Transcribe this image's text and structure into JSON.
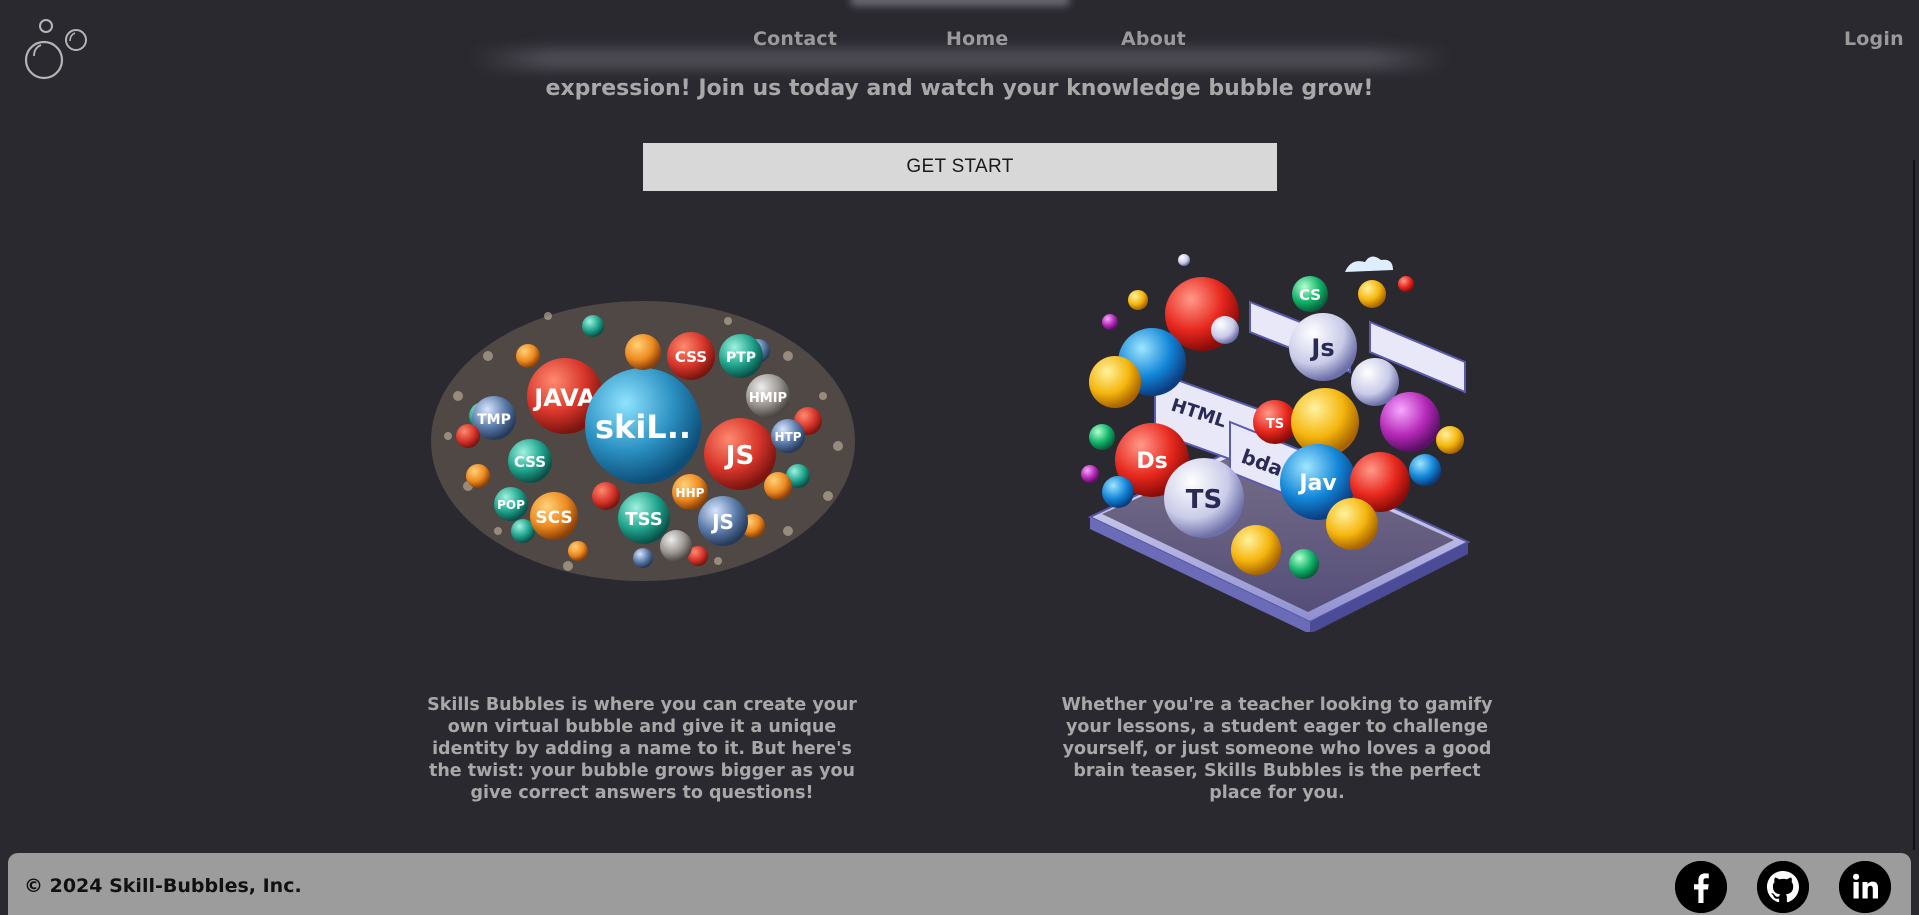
{
  "nav": {
    "contact": "Contact",
    "home": "Home",
    "about": "About",
    "login": "Login"
  },
  "hero": {
    "tagline": "expression! Join us today and watch your knowledge bubble grow!",
    "cta_label": "GET START"
  },
  "left_illustration": {
    "center_label": "skiL..",
    "bubble_labels": [
      "JAVA",
      "CSS",
      "JS",
      "TSS",
      "SCS",
      "JS",
      "PTP",
      "HMIP",
      "HTP",
      "TMP",
      "CSS",
      "POP",
      "HHP"
    ]
  },
  "right_illustration": {
    "bubble_labels": [
      "Js",
      "CS",
      "HTML",
      "TS",
      "Ds",
      "TS",
      "Jav",
      "bda"
    ]
  },
  "features": {
    "left_text": "Skills Bubbles is where you can create your own virtual bubble and give it a unique identity by adding a name to it. But here's the twist: your bubble grows bigger as you give correct answers to questions!",
    "right_text": "Whether you're a teacher looking to gamify your lessons, a student eager to challenge yourself, or just someone who loves a good brain teaser, Skills Bubbles is the perfect place for you."
  },
  "footer": {
    "copyright": "© 2024 Skill-Bubbles, Inc.",
    "social_icons": [
      "facebook-icon",
      "github-icon",
      "linkedin-icon"
    ]
  },
  "colors": {
    "background": "#2a2930",
    "footer": "#9c9c9c",
    "button": "#d8d8d8"
  }
}
